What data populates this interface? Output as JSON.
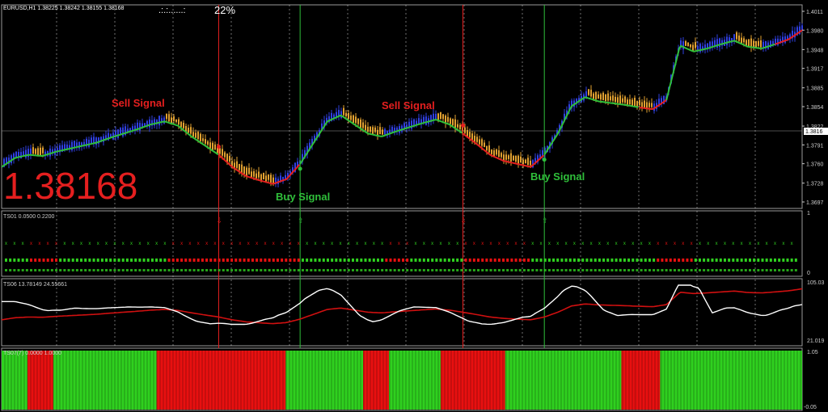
{
  "header": {
    "symbol_line": "EURUSD,H1  1.38225 1.38242 1.38155 1.38168",
    "progress_dots": ".:.:......:",
    "progress_text": "22%"
  },
  "big_price": "1.38168",
  "main_panel": {
    "price_ticks": [
      "1.4011",
      "1.3980",
      "1.3948",
      "1.3917",
      "1.3885",
      "1.3854",
      "1.3822",
      "1.3791",
      "1.3760",
      "1.3728",
      "1.3697"
    ],
    "current_price_label": "1.3816",
    "annotations": [
      {
        "text": "Sell Signal",
        "color": "#e51f1f"
      },
      {
        "text": "Buy Signal",
        "color": "#2fbf3a"
      },
      {
        "text": "Sell Signal",
        "color": "#e51f1f"
      },
      {
        "text": "Buy Signal",
        "color": "#2fbf3a"
      }
    ]
  },
  "panel_ts01": {
    "label": "TS01 0.0500 0.2200",
    "scale_top": "1",
    "scale_bottom": "0"
  },
  "panel_ts06": {
    "label": "TS06 13.78149 24.55661",
    "scale_top": "105.03",
    "scale_bottom": "21.019"
  },
  "panel_ts07": {
    "label": "TS07(7) 0.0000 1.0000",
    "scale_top": "1.05",
    "scale_bottom": "-0.05"
  },
  "colors": {
    "background": "#000000",
    "bull_candle": "#2f3fe0",
    "bear_candle": "#e0a030",
    "ma_up": "#2fbf3a",
    "ma_down": "#e51f1f",
    "osc_line": "#ffffff",
    "osc_signal": "#d01010",
    "hist_green": "#2fd01f",
    "hist_red": "#e81010"
  },
  "chart_data": {
    "type": "candlestick",
    "symbol": "EURUSD",
    "timeframe": "H1",
    "ylim": [
      1.3697,
      1.4011
    ],
    "close_path": [
      1.376,
      1.3775,
      1.378,
      1.3778,
      1.3785,
      1.379,
      1.3795,
      1.38,
      1.3808,
      1.3815,
      1.3822,
      1.383,
      1.3835,
      1.3828,
      1.381,
      1.3795,
      1.378,
      1.376,
      1.3745,
      1.3738,
      1.3732,
      1.374,
      1.3765,
      1.38,
      1.3835,
      1.3845,
      1.383,
      1.3815,
      1.381,
      1.3818,
      1.3825,
      1.3832,
      1.3838,
      1.383,
      1.3815,
      1.3798,
      1.378,
      1.377,
      1.3765,
      1.376,
      1.378,
      1.3815,
      1.386,
      1.3875,
      1.3868,
      1.3865,
      1.3862,
      1.3858,
      1.3855,
      1.387,
      1.396,
      1.395,
      1.3955,
      1.3962,
      1.3968,
      1.3958,
      1.3955,
      1.3962,
      1.397,
      1.3985
    ],
    "ma_switch_index": [
      [
        0,
        "up"
      ],
      [
        16,
        "down"
      ],
      [
        22,
        "up"
      ],
      [
        34,
        "down"
      ],
      [
        40,
        "up"
      ],
      [
        47,
        "down"
      ],
      [
        49,
        "up"
      ],
      [
        57,
        "down"
      ]
    ],
    "signals": [
      {
        "index": 16,
        "type": "sell"
      },
      {
        "index": 22,
        "type": "buy"
      },
      {
        "index": 34,
        "type": "sell"
      },
      {
        "index": 40,
        "type": "buy"
      }
    ],
    "histogram_segments": [
      {
        "from": 0,
        "to": 2,
        "color": "green"
      },
      {
        "from": 2,
        "to": 4,
        "color": "red"
      },
      {
        "from": 4,
        "to": 12,
        "color": "green"
      },
      {
        "from": 12,
        "to": 22,
        "color": "red"
      },
      {
        "from": 22,
        "to": 28,
        "color": "green"
      },
      {
        "from": 28,
        "to": 30,
        "color": "red"
      },
      {
        "from": 30,
        "to": 34,
        "color": "green"
      },
      {
        "from": 34,
        "to": 39,
        "color": "red"
      },
      {
        "from": 39,
        "to": 48,
        "color": "green"
      },
      {
        "from": 48,
        "to": 49,
        "color": "red"
      },
      {
        "from": 49,
        "to": 51,
        "color": "red"
      },
      {
        "from": 51,
        "to": 62,
        "color": "green"
      }
    ]
  }
}
